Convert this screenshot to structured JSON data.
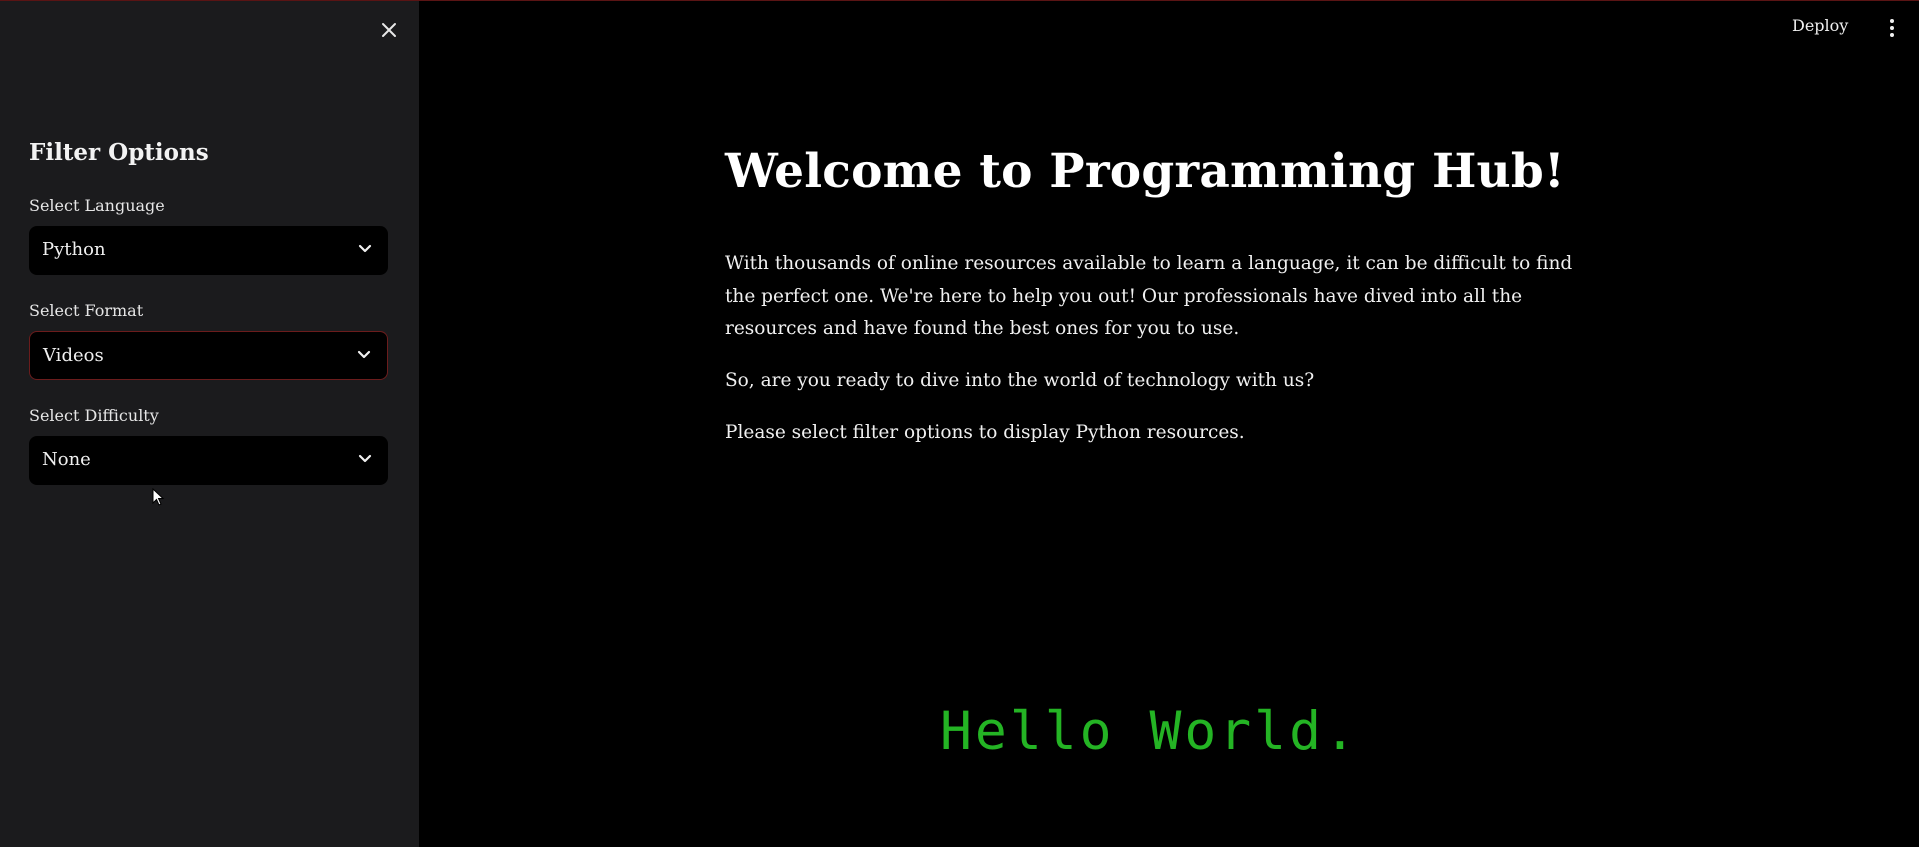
{
  "sidebar": {
    "title": "Filter Options",
    "filters": [
      {
        "label": "Select Language",
        "value": "Python"
      },
      {
        "label": "Select Format",
        "value": "Videos"
      },
      {
        "label": "Select Difficulty",
        "value": "None"
      }
    ],
    "close_icon": "close-icon"
  },
  "header": {
    "deploy_label": "Deploy",
    "menu_icon": "kebab-menu-icon"
  },
  "main": {
    "title": "Welcome to Programming Hub!",
    "paragraphs": [
      "With thousands of online resources available to learn a language, it can be difficult to find the perfect one. We're here to help you out! Our professionals have dived into all the resources and have found the best ones for you to use.",
      "So, are you ready to dive into the world of technology with us?",
      "Please select filter options to display Python resources."
    ],
    "animation_text": "Hello World."
  },
  "colors": {
    "sidebar_bg": "#1b1b1d",
    "main_bg": "#000000",
    "accent_green": "#24b424",
    "focus_border": "#6b1c1c"
  }
}
